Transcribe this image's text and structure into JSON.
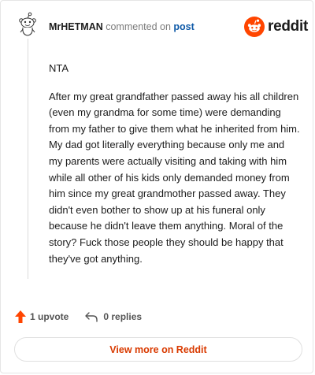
{
  "header": {
    "username": "MrHETMAN",
    "action_text": "commented on",
    "post_link": "post",
    "brand": "reddit"
  },
  "comment": {
    "paragraphs": [
      "NTA",
      "After my great grandfather passed away his all children (even my grandma for some time) were demanding from my father to give them what he inherited from him. My dad got literally everything because only me and my parents were actually visiting and taking with him while all other of his kids only demanded money from him since my great grandmother passed away. They didn't even bother to show up at his funeral only because he didn't leave them anything. Moral of the story? Fuck those people they should be happy that they've got anything."
    ]
  },
  "actions": {
    "upvotes": "1 upvote",
    "replies": "0 replies"
  },
  "footer": {
    "view_more": "View more on Reddit"
  },
  "colors": {
    "brand_orange": "#ff4500",
    "link_blue": "#0f5aa8",
    "view_more_text": "#d93a00"
  },
  "icons": {
    "avatar": "snoo-avatar-icon",
    "logo": "reddit-logo-icon",
    "upvote": "upvote-arrow-icon",
    "reply": "reply-arrow-icon"
  }
}
